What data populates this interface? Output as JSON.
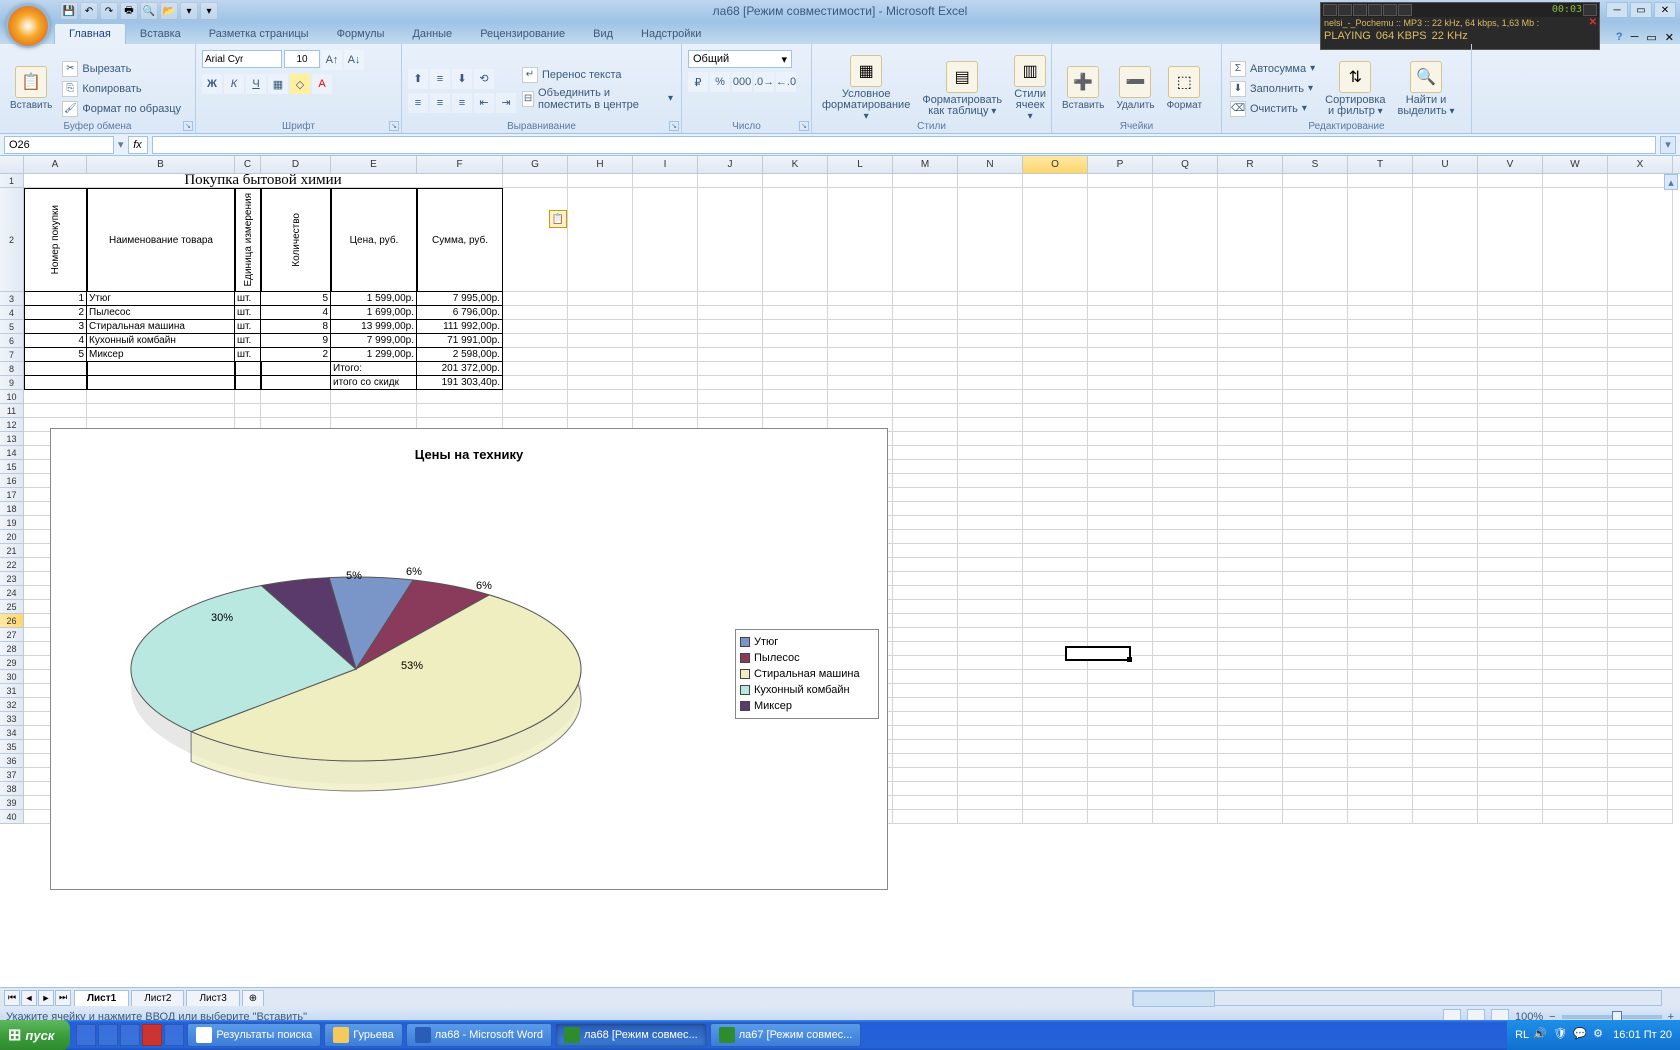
{
  "title": "ла68  [Режим совместимости] - Microsoft Excel",
  "media": {
    "track": "nelsi_-_Pochemu :: MP3 :: 22 kHz, 64 kbps, 1,63 Mb :",
    "status": "PLAYING",
    "bitrate": "064 KBPS",
    "freq": "22 KHz",
    "time": "00:03"
  },
  "tabs": {
    "home": "Главная",
    "insert": "Вставка",
    "layout": "Разметка страницы",
    "formulas": "Формулы",
    "data": "Данные",
    "review": "Рецензирование",
    "view": "Вид",
    "addins": "Надстройки"
  },
  "ribbon": {
    "paste": "Вставить",
    "cut": "Вырезать",
    "copy": "Копировать",
    "fmtpaint": "Формат по образцу",
    "clipboard": "Буфер обмена",
    "fontname": "Arial Cyr",
    "fontsize": "10",
    "font_group": "Шрифт",
    "wrap": "Перенос текста",
    "merge": "Объединить и поместить в центре",
    "align_group": "Выравнивание",
    "numfmt": "Общий",
    "num_group": "Число",
    "condfmt": "Условное",
    "condfmt2": "форматирование",
    "fmttable": "Форматировать",
    "fmttable2": "как таблицу",
    "cellstyle": "Стили",
    "cellstyle2": "ячеек",
    "styles_group": "Стили",
    "ins": "Вставить",
    "del": "Удалить",
    "fmt": "Формат",
    "cells_group": "Ячейки",
    "autosum": "Автосумма",
    "fill": "Заполнить",
    "clear": "Очистить",
    "sort": "Сортировка",
    "sort2": "и фильтр",
    "find": "Найти и",
    "find2": "выделить",
    "edit_group": "Редактирование"
  },
  "namebox": "O26",
  "cols": [
    "A",
    "B",
    "C",
    "D",
    "E",
    "F",
    "G",
    "H",
    "I",
    "J",
    "K",
    "L",
    "M",
    "N",
    "O",
    "P",
    "Q",
    "R",
    "S",
    "T",
    "U",
    "V",
    "W",
    "X"
  ],
  "table": {
    "title": "Покупка бытовой химии",
    "h_num": "Номер покупки",
    "h_name": "Наименование товара",
    "h_unit": "Единица измерения",
    "h_qty": "Количество",
    "h_price": "Цена, руб.",
    "h_sum": "Сумма, руб.",
    "rows": [
      {
        "n": "1",
        "name": "Утюг",
        "u": "шт.",
        "q": "5",
        "p": "1 599,00р.",
        "s": "7 995,00р."
      },
      {
        "n": "2",
        "name": "Пылесос",
        "u": "шт.",
        "q": "4",
        "p": "1 699,00р.",
        "s": "6 796,00р."
      },
      {
        "n": "3",
        "name": "Стиральная машина",
        "u": "шт.",
        "q": "8",
        "p": "13 999,00р.",
        "s": "111 992,00р."
      },
      {
        "n": "4",
        "name": "Кухонный комбайн",
        "u": "шт.",
        "q": "9",
        "p": "7 999,00р.",
        "s": "71 991,00р."
      },
      {
        "n": "5",
        "name": "Миксер",
        "u": "шт.",
        "q": "2",
        "p": "1 299,00р.",
        "s": "2 598,00р."
      }
    ],
    "total_lbl": "Итого:",
    "total": "201 372,00р.",
    "disc_lbl": "итого со скидк",
    "disc": "191 303,40р."
  },
  "chart_data": {
    "type": "pie",
    "title": "Цены на технику",
    "categories": [
      "Утюг",
      "Пылесос",
      "Стиральная машина",
      "Кухонный комбайн",
      "Миксер"
    ],
    "values": [
      6,
      6,
      53,
      30,
      5
    ],
    "labels": [
      "6%",
      "6%",
      "53%",
      "30%",
      "5%"
    ],
    "colors": [
      "#7a96c8",
      "#8a3a5a",
      "#eeeec0",
      "#b8e8e0",
      "#5a3a6a"
    ]
  },
  "sheets": {
    "s1": "Лист1",
    "s2": "Лист2",
    "s3": "Лист3"
  },
  "status": "Укажите ячейку и нажмите ВВОД или выберите \"Вставить\"",
  "zoom": "100%",
  "lang": "RL",
  "taskbar": {
    "start": "пуск",
    "btn1": "Результаты поиска",
    "btn2": "Гурьева",
    "btn3": "ла68 - Microsoft Word",
    "btn4": "ла68  [Режим совмес...",
    "btn5": "ла67  [Режим совмес...",
    "time": "16:01",
    "date": "Пт 20"
  },
  "colw": {
    "A": 63,
    "B": 148,
    "C": 26,
    "D": 70,
    "E": 86,
    "F": 86,
    "G": 65,
    "rest": 65
  }
}
